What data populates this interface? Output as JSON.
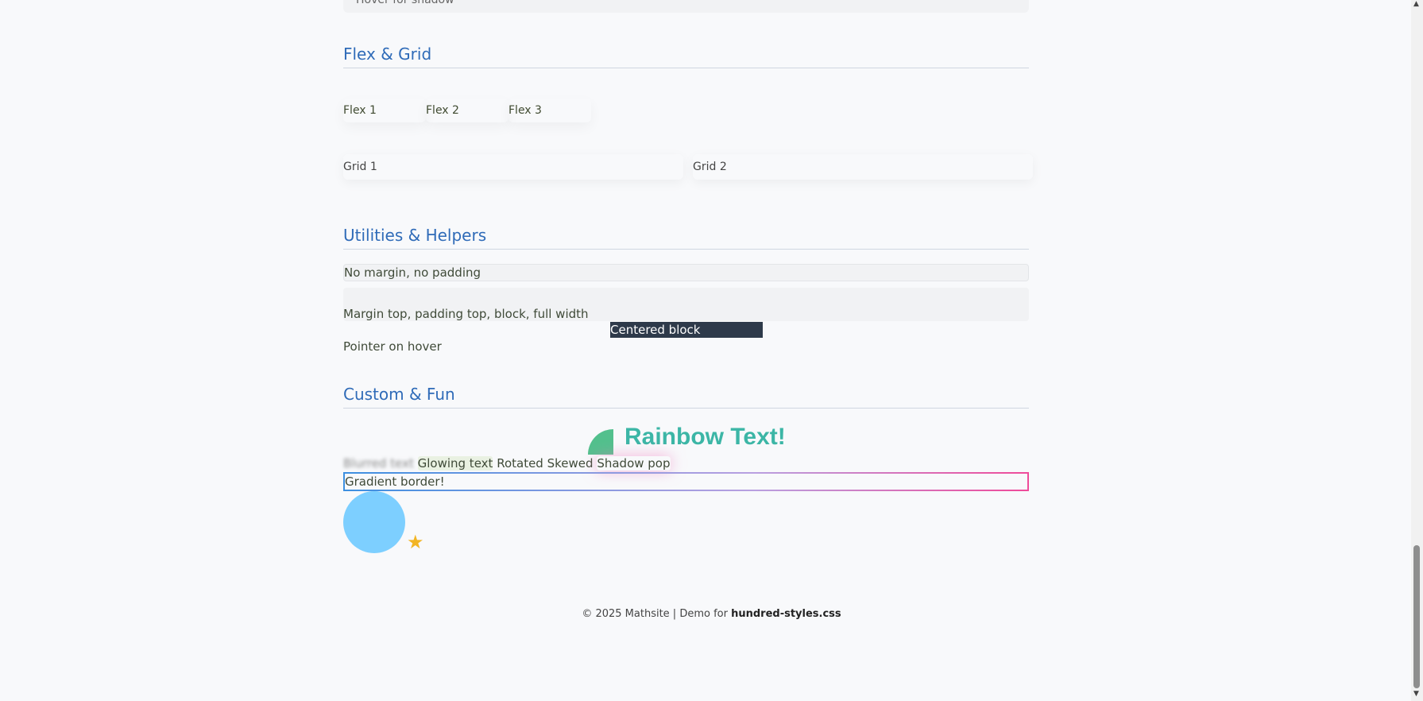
{
  "previous_card": {
    "label": "Hover for shadow"
  },
  "sections": {
    "flex_grid": {
      "title": "Flex & Grid"
    },
    "utilities": {
      "title": "Utilities & Helpers"
    },
    "custom_fun": {
      "title": "Custom & Fun"
    }
  },
  "flex_items": [
    "Flex 1",
    "Flex 2",
    "Flex 3"
  ],
  "grid_items": [
    "Grid 1",
    "Grid 2"
  ],
  "utilities": {
    "no_margin": "No margin, no padding",
    "margin_top": "Margin top, padding top, block, full width",
    "centered": "Centered block",
    "pointer": "Pointer on hover"
  },
  "fun": {
    "rainbow": "Rainbow Text!",
    "blurred": "Blurred text",
    "glowing": "Glowing text",
    "rotated": "Rotated",
    "skewed": "Skewed",
    "shadow_pop": "Shadow pop",
    "gradient_border": "Gradient border!",
    "star_icon": "★"
  },
  "footer": {
    "text": "© 2025 Mathsite | Demo for",
    "bold": "hundred-styles.css"
  },
  "colors": {
    "accent": "#2f6bb8",
    "centered_bg": "#2e3a4a",
    "bubble": "#7dcfff",
    "star": "#f2b524"
  }
}
